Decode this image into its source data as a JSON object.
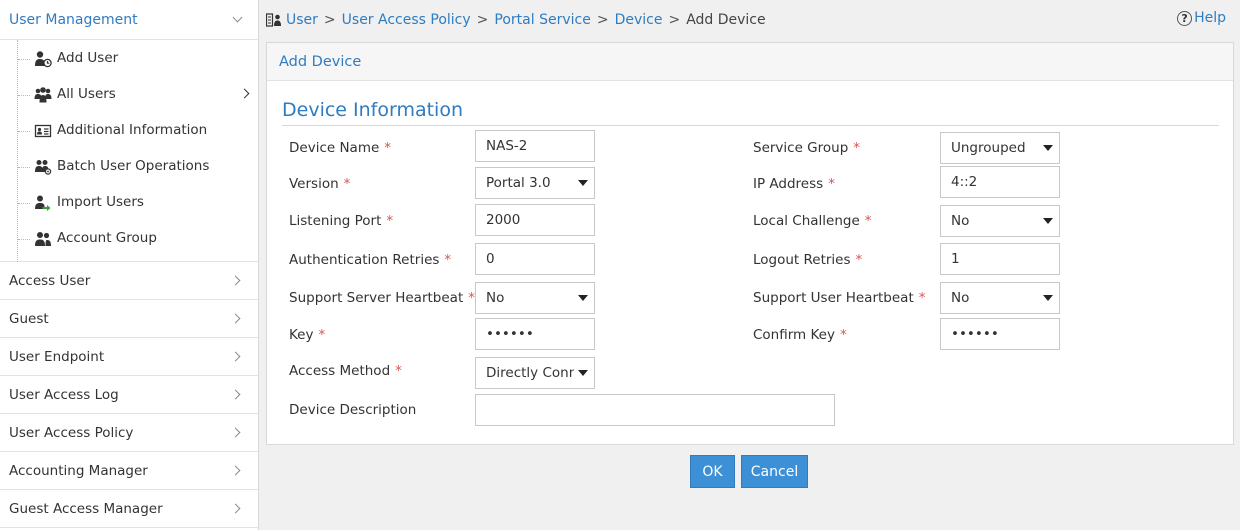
{
  "sidebar": {
    "head": {
      "label": "User Management"
    },
    "sub_items": [
      {
        "label": "Add User",
        "icon": "add-user-icon"
      },
      {
        "label": "All Users",
        "icon": "all-users-icon"
      },
      {
        "label": "Additional Information",
        "icon": "id-card-icon"
      },
      {
        "label": "Batch User Operations",
        "icon": "batch-users-icon"
      },
      {
        "label": "Import Users",
        "icon": "import-users-icon"
      },
      {
        "label": "Account Group",
        "icon": "account-group-icon"
      }
    ],
    "menu": [
      "Access User",
      "Guest",
      "User Endpoint",
      "User Access Log",
      "User Access Policy",
      "Accounting Manager",
      "Guest Access Manager"
    ]
  },
  "breadcrumb": {
    "items": [
      "User",
      "User Access Policy",
      "Portal Service",
      "Device"
    ],
    "current": "Add Device",
    "separator": ">"
  },
  "help": {
    "label": "Help",
    "icon_glyph": "?"
  },
  "panel": {
    "title": "Add Device"
  },
  "section": {
    "title": "Device Information"
  },
  "form": {
    "required_mark": "*",
    "device_name": {
      "label": "Device Name",
      "value": "NAS-2"
    },
    "service_group": {
      "label": "Service Group",
      "value": "Ungrouped"
    },
    "version": {
      "label": "Version",
      "value": "Portal 3.0"
    },
    "ip_address": {
      "label": "IP Address",
      "value": "4::2"
    },
    "listening_port": {
      "label": "Listening Port",
      "value": "2000"
    },
    "local_challenge": {
      "label": "Local Challenge",
      "value": "No"
    },
    "auth_retries": {
      "label": "Authentication Retries",
      "value": "0"
    },
    "logout_retries": {
      "label": "Logout Retries",
      "value": "1"
    },
    "server_heartbeat": {
      "label": "Support Server Heartbeat",
      "value": "No"
    },
    "user_heartbeat": {
      "label": "Support User Heartbeat",
      "value": "No"
    },
    "key": {
      "label": "Key",
      "value": "••••••"
    },
    "confirm_key": {
      "label": "Confirm Key",
      "value": "••••••"
    },
    "access_method": {
      "label": "Access Method",
      "value": "Directly Conne"
    },
    "device_description": {
      "label": "Device Description",
      "value": ""
    }
  },
  "buttons": {
    "ok": "OK",
    "cancel": "Cancel"
  },
  "colors": {
    "accent": "#2f7cc0",
    "button": "#3d8fd6",
    "required": "#d9534f"
  }
}
